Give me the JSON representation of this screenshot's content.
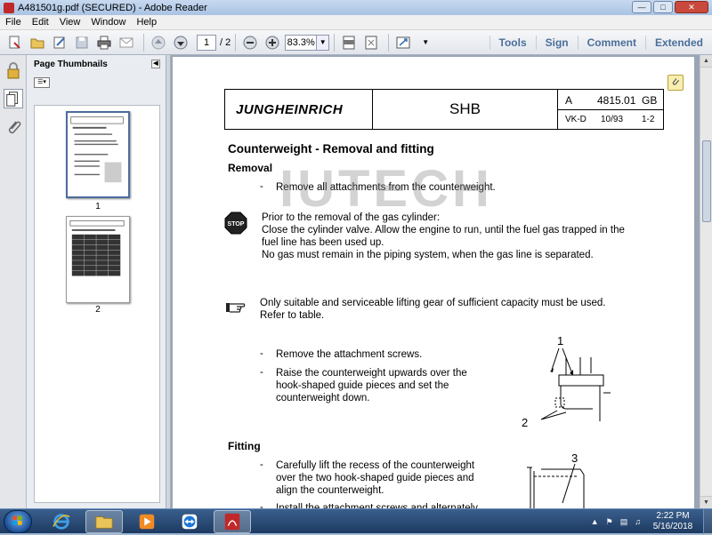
{
  "window": {
    "title": "A481501g.pdf (SECURED) - Adobe Reader"
  },
  "menu": [
    "File",
    "Edit",
    "View",
    "Window",
    "Help"
  ],
  "toolbar": {
    "page_current": "1",
    "page_total": "/ 2",
    "zoom": "83.3%"
  },
  "panel_links": [
    "Tools",
    "Sign",
    "Comment",
    "Extended"
  ],
  "sidebar": {
    "title": "Page Thumbnails",
    "thumbnails": [
      {
        "label": "1"
      },
      {
        "label": "2"
      }
    ]
  },
  "document": {
    "logo": "JUNGHEINRICH",
    "shb": "SHB",
    "code_a": "A",
    "code_num": "4815.01",
    "code_lang": "GB",
    "vk": "VK-D",
    "date": "10/93",
    "rev": "1-2",
    "heading": "Counterweight - Removal and fitting",
    "removal_heading": "Removal",
    "step_remove_attachments": "Remove all attachments from the counterweight.",
    "stop_lines": [
      "Prior to the removal of the gas cylinder:",
      "Close the cylinder valve. Allow the engine to run, until the fuel gas trapped in the",
      "fuel line has been used up.",
      "No gas must remain in the piping system, when the gas line is separated."
    ],
    "stop_label": "STOP",
    "note_lines": [
      "Only suitable and serviceable lifting gear of sufficient capacity must be used.",
      "Refer to table."
    ],
    "step_remove_screws": "Remove the attachment screws.",
    "step_raise_lines": [
      "Raise the counterweight upwards over the",
      "hook-shaped guide pieces and set the",
      "counterweight down."
    ],
    "fitting_heading": "Fitting",
    "step_lift_lines": [
      "Carefully lift the recess of the counterweight",
      "over the two hook-shaped guide pieces and",
      "align the counterweight."
    ],
    "step_install_partial": "Install the attachment screws and alternately",
    "figure_labels": [
      "1",
      "2",
      "3"
    ],
    "dash": "-",
    "watermark": "IUTECH"
  },
  "taskbar": {
    "time": "2:22 PM",
    "date": "5/16/2018"
  }
}
